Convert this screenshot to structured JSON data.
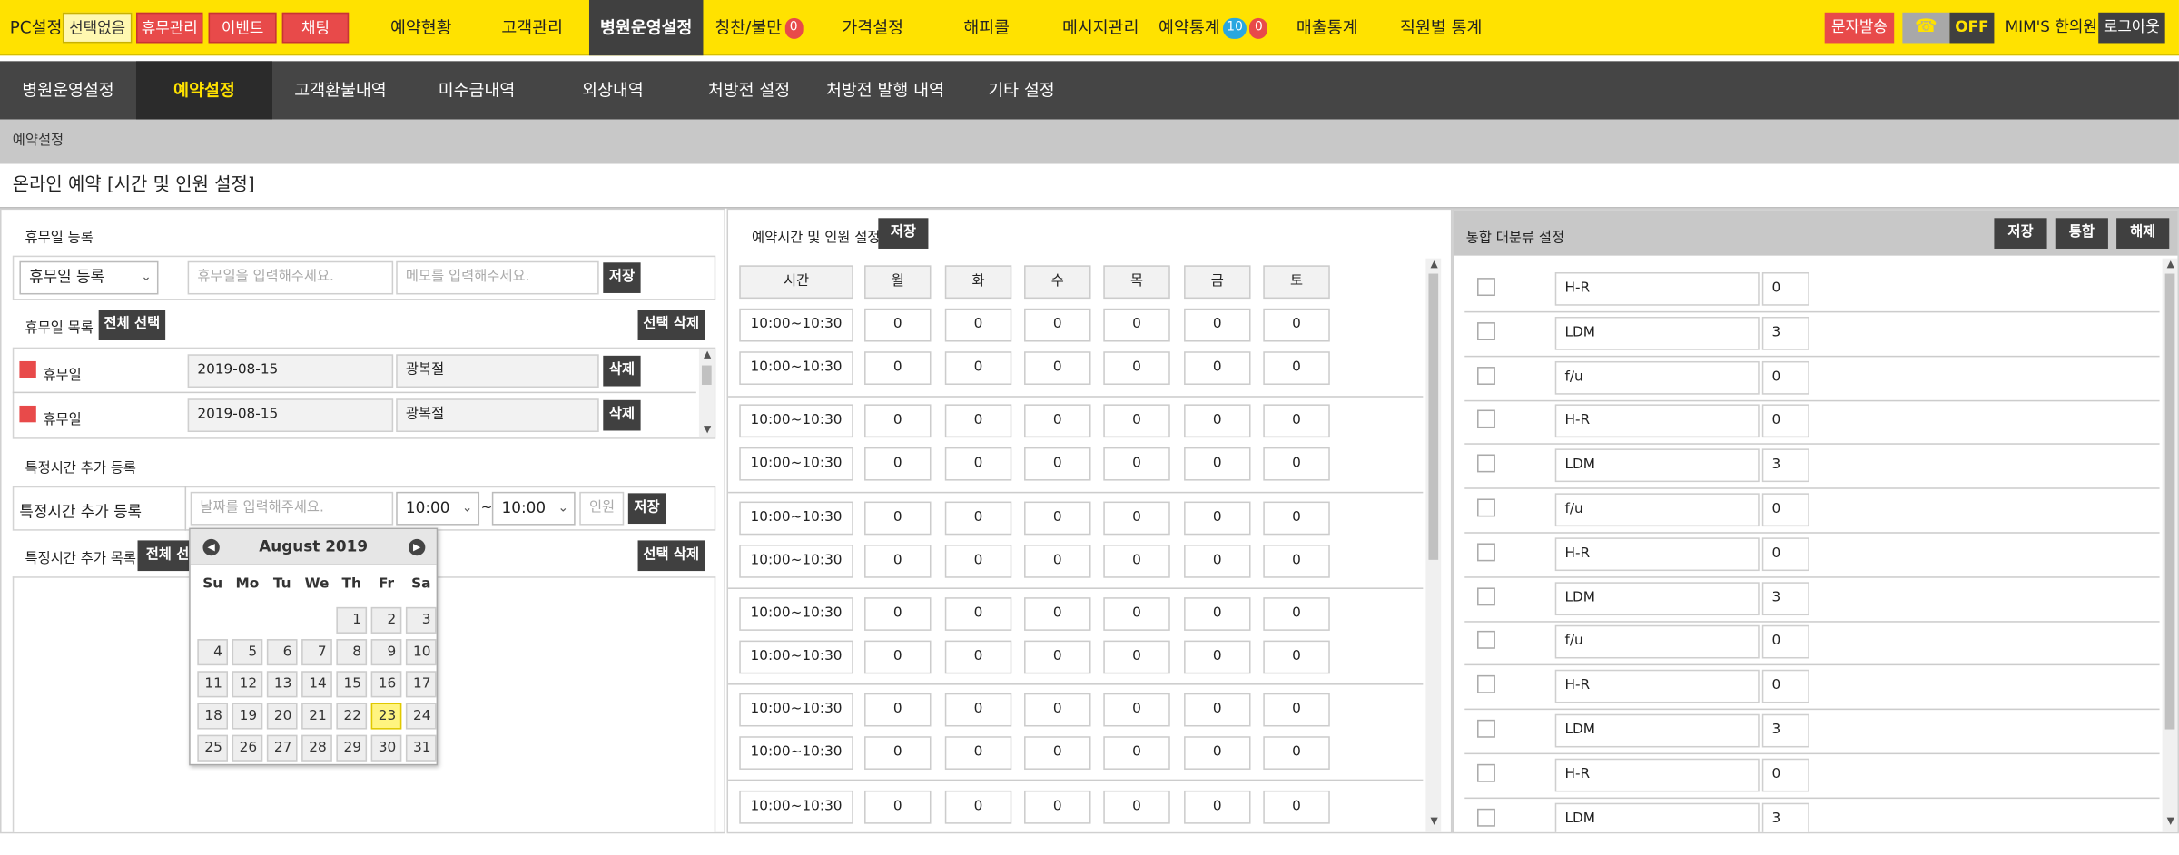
{
  "topbar": {
    "pc_setting": "PC설정",
    "no_select": "선택없음",
    "pills": [
      "휴무관리",
      "이벤트",
      "채팅"
    ],
    "nav": [
      {
        "label": "예약현황"
      },
      {
        "label": "고객관리"
      },
      {
        "label": "병원운영설정",
        "active": true
      },
      {
        "label": "칭찬/불만",
        "badge": "0"
      },
      {
        "label": "가격설정"
      },
      {
        "label": "해피콜"
      },
      {
        "label": "메시지관리"
      },
      {
        "label": "예약통계",
        "badge_blue": "10",
        "badge": "0"
      },
      {
        "label": "매출통계"
      },
      {
        "label": "직원별 통계"
      }
    ],
    "sms_button": "문자발송",
    "phone_status": "OFF",
    "clinic_name": "MIM'S 한의원",
    "logout": "로그아웃"
  },
  "subnav": [
    "병원운영설정",
    "예약설정",
    "고객환불내역",
    "미수금내역",
    "외상내역",
    "처방전 설정",
    "처방전 발행 내역",
    "기타 설정"
  ],
  "breadcrumb": "예약설정",
  "page_title": "온라인 예약 [시간 및 인원 설정]",
  "left": {
    "holiday_register_title": "휴무일 등록",
    "holiday_select": "휴무일 등록",
    "holiday_input_placeholder": "휴무일을 입력해주세요.",
    "memo_placeholder": "메모를 입력해주세요.",
    "save": "저장",
    "holiday_list_title": "휴무일 목록",
    "select_all": "전체 선택",
    "delete_selected": "선택 삭제",
    "holiday_rows": [
      {
        "type": "휴무일",
        "date": "2019-08-15",
        "memo": "광복절",
        "action": "삭제"
      },
      {
        "type": "휴무일",
        "date": "2019-08-15",
        "memo": "광복절",
        "action": "삭제"
      }
    ],
    "special_title": "특정시간 추가 등록",
    "special_label": "특정시간 추가 등록",
    "date_placeholder": "날짜를 입력해주세요.",
    "start_time": "10:00",
    "tilde": "~",
    "end_time": "10:00",
    "people_placeholder": "인원",
    "special_list_title": "특정시간 추가 목록",
    "select_all_partial": "전체 선택",
    "calendar": {
      "title": "August 2019",
      "dow": [
        "Su",
        "Mo",
        "Tu",
        "We",
        "Th",
        "Fr",
        "Sa"
      ],
      "weeks": [
        [
          "",
          "",
          "",
          "",
          "1",
          "2",
          "3"
        ],
        [
          "4",
          "5",
          "6",
          "7",
          "8",
          "9",
          "10"
        ],
        [
          "11",
          "12",
          "13",
          "14",
          "15",
          "16",
          "17"
        ],
        [
          "18",
          "19",
          "20",
          "21",
          "22",
          "23",
          "24"
        ],
        [
          "25",
          "26",
          "27",
          "28",
          "29",
          "30",
          "31"
        ]
      ],
      "highlighted": "23"
    }
  },
  "middle": {
    "title": "예약시간 및 인원 설정",
    "save": "저장",
    "headers": [
      "시간",
      "월",
      "화",
      "수",
      "목",
      "금",
      "토"
    ],
    "rows": [
      [
        "10:00~10:30",
        "0",
        "0",
        "0",
        "0",
        "0",
        "0"
      ],
      [
        "10:00~10:30",
        "0",
        "0",
        "0",
        "0",
        "0",
        "0"
      ],
      [
        "10:00~10:30",
        "0",
        "0",
        "0",
        "0",
        "0",
        "0"
      ],
      [
        "10:00~10:30",
        "0",
        "0",
        "0",
        "0",
        "0",
        "0"
      ],
      [
        "10:00~10:30",
        "0",
        "0",
        "0",
        "0",
        "0",
        "0"
      ],
      [
        "10:00~10:30",
        "0",
        "0",
        "0",
        "0",
        "0",
        "0"
      ],
      [
        "10:00~10:30",
        "0",
        "0",
        "0",
        "0",
        "0",
        "0"
      ],
      [
        "10:00~10:30",
        "0",
        "0",
        "0",
        "0",
        "0",
        "0"
      ],
      [
        "10:00~10:30",
        "0",
        "0",
        "0",
        "0",
        "0",
        "0"
      ],
      [
        "10:00~10:30",
        "0",
        "0",
        "0",
        "0",
        "0",
        "0"
      ],
      [
        "10:00~10:30",
        "0",
        "0",
        "0",
        "0",
        "0",
        "0"
      ]
    ]
  },
  "right": {
    "title": "통합 대분류 설정",
    "save": "저장",
    "merge": "통합",
    "unmerge": "해제",
    "rows": [
      {
        "name": "H-R",
        "value": "0"
      },
      {
        "name": "LDM",
        "value": "3"
      },
      {
        "name": "f/u",
        "value": "0"
      },
      {
        "name": "H-R",
        "value": "0"
      },
      {
        "name": "LDM",
        "value": "3"
      },
      {
        "name": "f/u",
        "value": "0"
      },
      {
        "name": "H-R",
        "value": "0"
      },
      {
        "name": "LDM",
        "value": "3"
      },
      {
        "name": "f/u",
        "value": "0"
      },
      {
        "name": "H-R",
        "value": "0"
      },
      {
        "name": "LDM",
        "value": "3"
      },
      {
        "name": "H-R",
        "value": "0"
      },
      {
        "name": "LDM",
        "value": "3"
      }
    ]
  },
  "colors": {
    "brand_yellow": "#ffe200",
    "dark": "#404040",
    "red": "#e84a4a",
    "blue_badge": "#2aa7e0"
  }
}
